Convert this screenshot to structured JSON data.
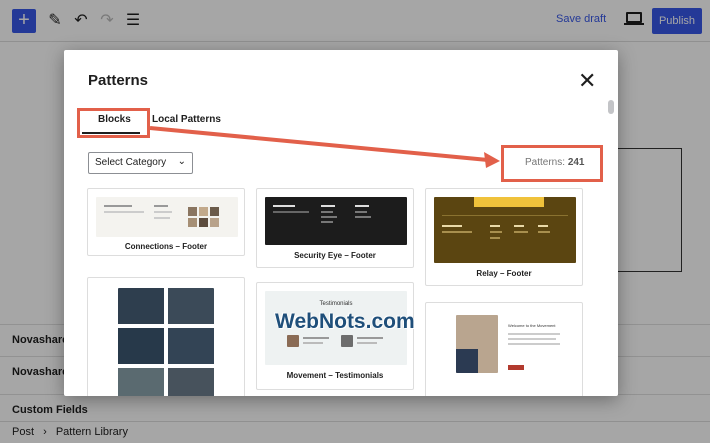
{
  "toolbar": {
    "inserter_symbol": "+",
    "save_draft_label": "Save draft",
    "publish_label": "Publish"
  },
  "sidebar": {
    "rows": [
      "Novashare",
      "Novashare",
      "Custom Fields"
    ]
  },
  "breadcrumb": {
    "items": [
      "Post",
      "Pattern Library"
    ],
    "separator": "›"
  },
  "modal": {
    "title": "Patterns",
    "tabs": [
      "Blocks",
      "Local Patterns"
    ],
    "category_select": "Select Category",
    "count_label": "Patterns:",
    "count_value": "241",
    "patterns": [
      "Connections – Footer",
      "Security Eye – Footer",
      "Relay – Footer",
      "Movement – Testimonials"
    ],
    "preview_texts": {
      "testimonials_heading": "Testimonials",
      "welcome_heading": "Welcome to the Movement"
    }
  },
  "watermark": "WebNots.com",
  "colors": {
    "accent": "#3858e9",
    "highlight": "#e2604a",
    "relay_bg": "#5b4511",
    "relay_banner": "#f0c23b"
  },
  "icons": [
    "pencil-icon",
    "undo-icon",
    "redo-icon",
    "list-view-icon",
    "desktop-view-icon",
    "close-icon",
    "chevron-down-icon"
  ]
}
